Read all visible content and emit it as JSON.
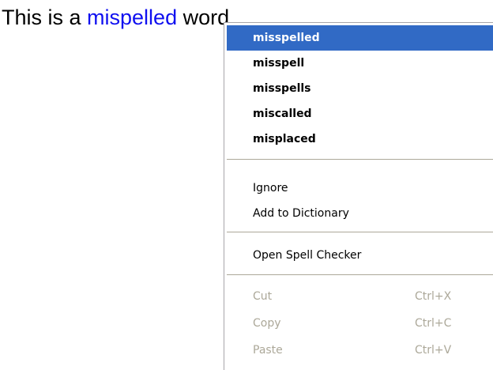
{
  "document": {
    "prefix": "This is a ",
    "word": "mispelled",
    "suffix": " word"
  },
  "context_menu": {
    "suggestions": [
      "misspelled",
      "misspell",
      "misspells",
      "miscalled",
      "misplaced"
    ],
    "selected_index": 0,
    "actions": {
      "ignore": "Ignore",
      "add_to_dictionary": "Add to Dictionary",
      "open_spell_checker": "Open Spell Checker"
    },
    "edit": {
      "cut": {
        "label": "Cut",
        "shortcut": "Ctrl+X",
        "enabled": false
      },
      "copy": {
        "label": "Copy",
        "shortcut": "Ctrl+C",
        "enabled": false
      },
      "paste": {
        "label": "Paste",
        "shortcut": "Ctrl+V",
        "enabled": false
      }
    }
  },
  "colors": {
    "misspelled_word": "#1010f0",
    "selection_background": "#316ac5",
    "disabled_text": "#aca899"
  }
}
